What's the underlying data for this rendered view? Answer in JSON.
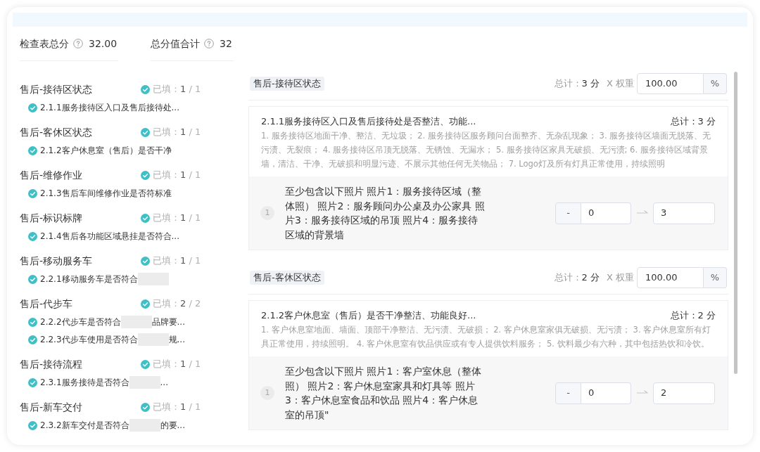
{
  "summary": [
    {
      "label": "检查表总分",
      "value": "32.00"
    },
    {
      "label": "总分值合计",
      "value": "32"
    }
  ],
  "sidebar": {
    "groups": [
      {
        "title": "售后-接待区状态",
        "checked": true,
        "status": "已填：**1** / 1",
        "items": [
          {
            "text": "2.1.1服务接待区入口及售后接待处...",
            "checked": true,
            "redacted": false
          }
        ]
      },
      {
        "title": "售后-客休区状态",
        "checked": true,
        "status": "已填：**1** / 1",
        "items": [
          {
            "text": "2.1.2客户休息室（售后）是否干净",
            "checked": true,
            "redacted": false
          }
        ]
      },
      {
        "title": "售后-维修作业",
        "checked": true,
        "status": "已填：**1** / 1",
        "items": [
          {
            "text": "2.1.3售后车间维修作业是否符标准",
            "checked": true,
            "redacted": false
          }
        ]
      },
      {
        "title": "售后-标识标牌",
        "checked": true,
        "status": "已填：**1** / 1",
        "items": [
          {
            "text": "2.1.4售后各功能区域悬挂是否符合...",
            "checked": true,
            "redacted": false
          }
        ]
      },
      {
        "title": "售后-移动服务车",
        "checked": true,
        "status": "已填：**1** / 1",
        "items": [
          {
            "text": "2.2.1移动服务车是否符合",
            "checked": true,
            "redacted": true
          }
        ]
      },
      {
        "title": "售后-代步车",
        "checked": true,
        "status": "已填：**2** / 2",
        "items": [
          {
            "text": "2.2.2代步车是否符合",
            "checked": true,
            "redacted": true,
            "text_after": "品牌要..."
          },
          {
            "text": "2.2.3代步车使用是否符合",
            "checked": true,
            "redacted": true,
            "text_after": "规..."
          }
        ]
      },
      {
        "title": "售后-接待流程",
        "checked": true,
        "status": "已填：**1** / 1",
        "items": [
          {
            "text": "2.3.1服务接待是否符合",
            "checked": true,
            "redacted": true,
            "text_after": "..."
          }
        ]
      },
      {
        "title": "售后-新车交付",
        "checked": true,
        "status": "已填：**1** / 1",
        "items": [
          {
            "text": "2.3.2新车交付是否符合",
            "checked": true,
            "redacted": true,
            "text_after": "的要..."
          }
        ]
      }
    ]
  },
  "sections": [
    {
      "tag": "售后-接待区状态",
      "total": "总计：**3 分**",
      "weight_label": "X 权重",
      "weight": "100.00",
      "unit": "%",
      "items": [
        {
          "title": "2.1.1服务接待区入口及售后接待处是否整洁、功能...",
          "total": "总计：3 分",
          "description": "1. 服务接待区地面干净、整洁、无垃圾； 2. 服务接待区服务顾问台面整齐、无杂乱现象； 3. 服务接待区墙面无脱落、无污渍、无裂痕； 4. 服务接待区吊顶无脱落、无锈蚀、无漏水； 5. 服务接待区家具无破损、无污渍; 6. 服务接待区域背景墙，清洁、干净、无破损和明显污迹、不展示其他任何无关物品； 7. Logo灯及所有灯具正常使用，持续照明",
          "photos": [
            {
              "index": "1",
              "requirement": "至少包含以下照片 照片1：服务接待区域（整体照） 照片2：服务顾问办公桌及办公家具 照片3：服务接待区域的吊顶 照片4：服务接待区域的背景墙",
              "prefix": "-",
              "min": "0",
              "max": "3"
            }
          ]
        }
      ]
    },
    {
      "tag": "售后-客休区状态",
      "total": "总计：**2 分**",
      "weight_label": "X 权重",
      "weight": "100.00",
      "unit": "%",
      "items": [
        {
          "title": "2.1.2客户休息室（售后）是否干净整洁、功能良好...",
          "total": "总计：2 分",
          "description": "1. 客户休息室地面、墙面、顶部干净整洁、无污渍、无破损； 2. 客户休息室家俱无破损、无污渍； 3. 客户休息室所有灯具正常使用，持续照明。 4. 客户休息室有饮品供应或有专人提供饮料服务； 5. 饮料最少有六种，其中包括热饮和冷饮。",
          "photos": [
            {
              "index": "1",
              "requirement": "至少包含以下照片 照片1：客户室休息（整体照） 照片2：客户休息室家具和灯具等 照片3：客户休息室食品和饮品 照片4：客户休息室的吊顶\"",
              "prefix": "-",
              "min": "0",
              "max": "2"
            }
          ]
        }
      ]
    }
  ]
}
